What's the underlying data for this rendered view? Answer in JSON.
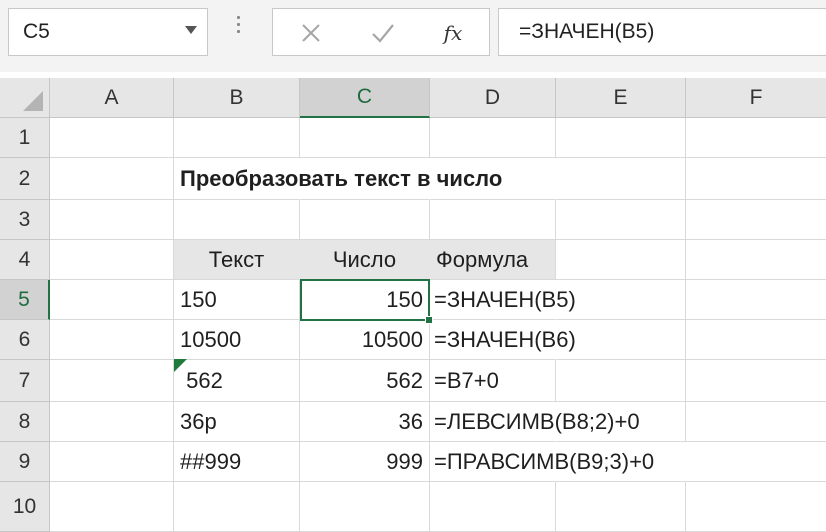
{
  "formula_bar": {
    "name_box": "C5",
    "formula": "=ЗНАЧЕН(B5)",
    "fx_label": "fx",
    "icons": {
      "cancel": "close-icon",
      "enter": "check-icon",
      "function": "fx-icon",
      "name_box_dropdown": "chevron-down-icon"
    }
  },
  "columns": [
    "A",
    "B",
    "C",
    "D",
    "E",
    "F"
  ],
  "selected_column": "C",
  "rows": [
    "1",
    "2",
    "3",
    "4",
    "5",
    "6",
    "7",
    "8",
    "9",
    "10"
  ],
  "selected_row": "5",
  "cells": {
    "B2": "Преобразовать текст в число",
    "B4": "Текст",
    "C4": "Число",
    "D4": "Формула",
    "B5": "150",
    "C5": "150",
    "D5": "=ЗНАЧЕН(B5)",
    "B6": "10500",
    "C6": "10500",
    "D6": "=ЗНАЧЕН(B6)",
    "B7": " 562",
    "C7": "562",
    "D7": "=B7+0",
    "B8": "36р",
    "C8": "36",
    "D8": "=ЛЕВСИМВ(B8;2)+0",
    "B9": "##999",
    "C9": "999",
    "D9": "=ПРАВСИМВ(B9;3)+0"
  },
  "colors": {
    "accent": "#217346",
    "header_bg": "#e6e6e6",
    "table_header_bg": "#e6e6e6"
  }
}
